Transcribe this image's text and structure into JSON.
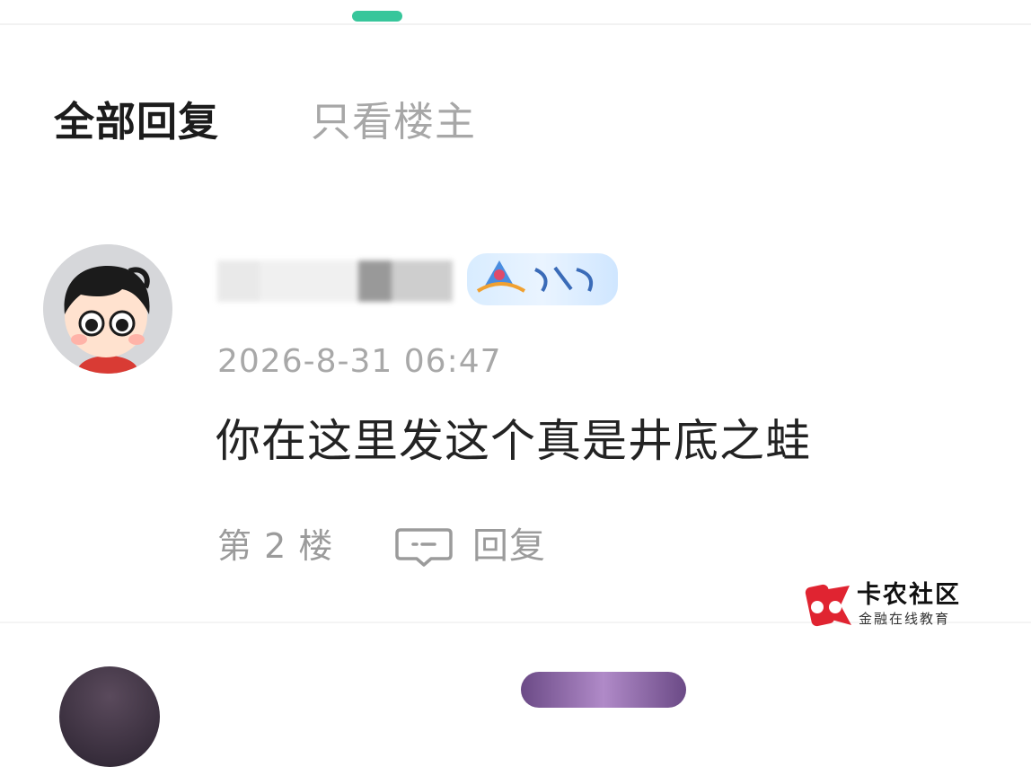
{
  "tabs": {
    "all_label": "全部回复",
    "op_label": "只看楼主"
  },
  "post": {
    "timestamp": "2026-8-31 06:47",
    "content": "你在这里发这个真是井底之蛙",
    "floor": "第 2 楼",
    "reply_label": "回复",
    "avatar_icon": "cartoon-boy-avatar",
    "badge_icon": "level-badge"
  },
  "watermark": {
    "title": "卡农社区",
    "subtitle": "金融在线教育"
  },
  "colors": {
    "accent": "#37c69b",
    "muted_text": "#a8a8a8",
    "watermark_red": "#e02431"
  }
}
